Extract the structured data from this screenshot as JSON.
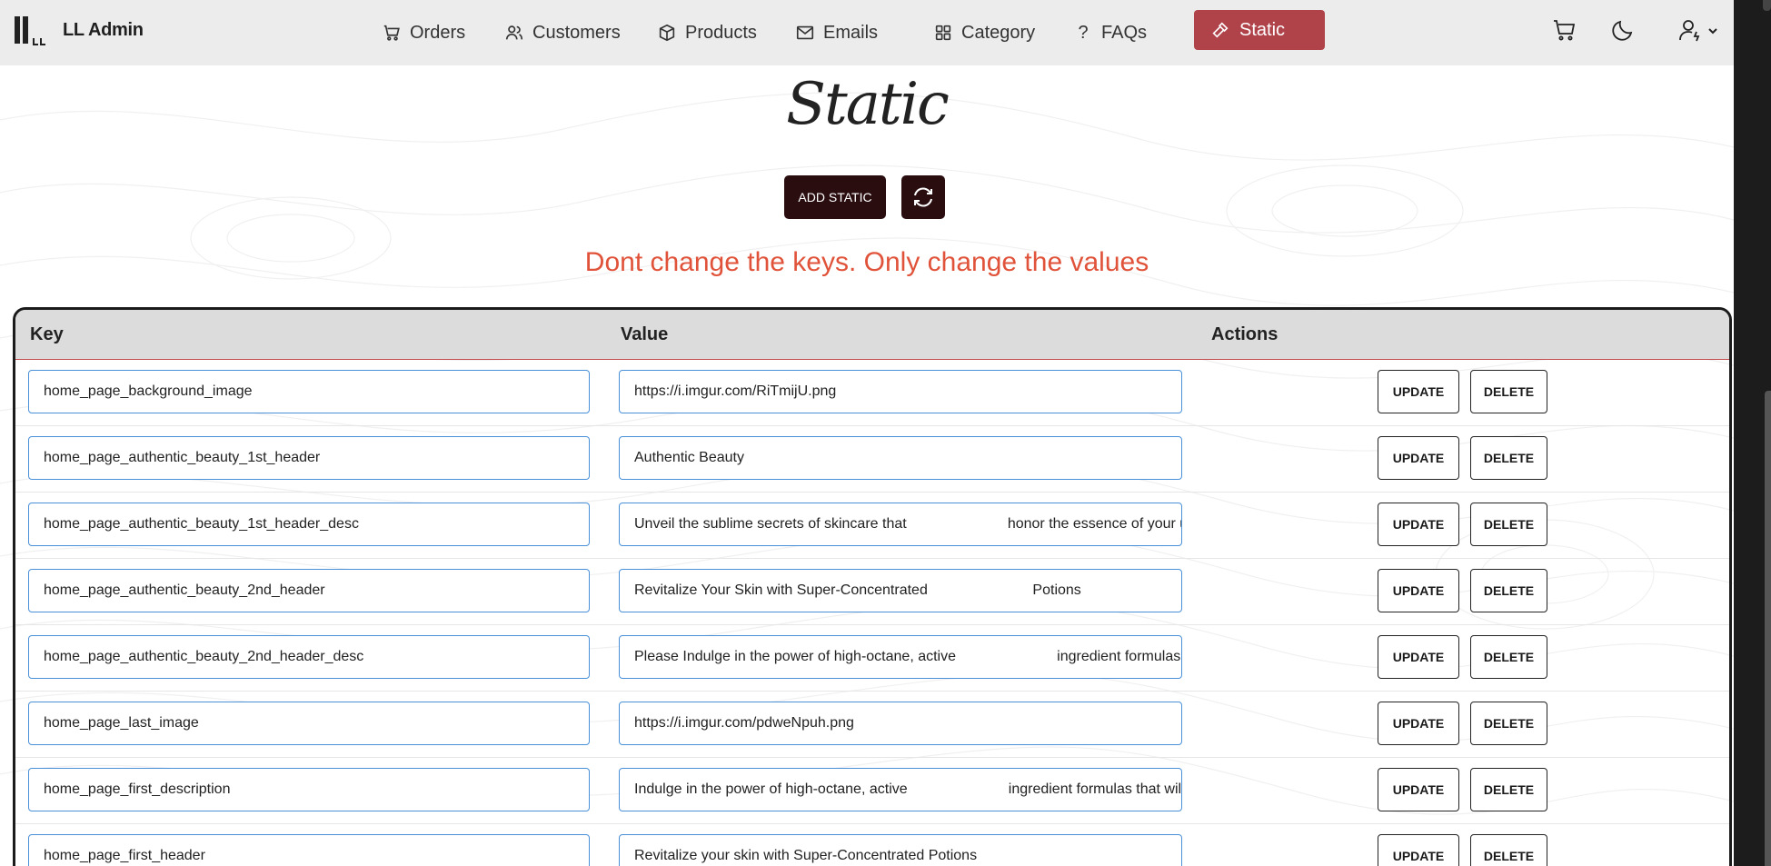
{
  "app": {
    "title": "LL Admin"
  },
  "nav": {
    "items": [
      {
        "label": "Orders",
        "icon": "cart-icon"
      },
      {
        "label": "Customers",
        "icon": "users-icon"
      },
      {
        "label": "Products",
        "icon": "box-icon"
      },
      {
        "label": "Emails",
        "icon": "mail-icon"
      },
      {
        "label": "Category",
        "icon": "grid-icon"
      },
      {
        "label": "FAQs",
        "icon": "question-icon"
      }
    ],
    "active": {
      "label": "Static",
      "icon": "hammer-icon",
      "color": "#b0424a"
    },
    "right_icons": [
      "cart-icon",
      "moon-icon",
      "user-settings-icon",
      "chevron-down-icon"
    ]
  },
  "page": {
    "title": "Static",
    "add_button": "ADD STATIC",
    "refresh_icon": "refresh-icon",
    "warning": "Dont change the keys. Only change the values",
    "warning_color": "#e0533a"
  },
  "table": {
    "headers": {
      "key": "Key",
      "value": "Value",
      "actions": "Actions"
    },
    "update_label": "UPDATE",
    "delete_label": "DELETE",
    "rows": [
      {
        "key": "home_page_background_image",
        "value": "https://i.imgur.com/RiTmijU.png"
      },
      {
        "key": "home_page_authentic_beauty_1st_header",
        "value": "Authentic Beauty"
      },
      {
        "key": "home_page_authentic_beauty_1st_header_desc",
        "value": "Unveil the sublime secrets of skincare that                         honor the essence of your u"
      },
      {
        "key": "home_page_authentic_beauty_2nd_header",
        "value": "Revitalize Your Skin with Super-Concentrated                          Potions"
      },
      {
        "key": "home_page_authentic_beauty_2nd_header_desc",
        "value": "Please Indulge in the power of high-octane, active                         ingredient formulas"
      },
      {
        "key": "home_page_last_image",
        "value": "https://i.imgur.com/pdweNpuh.png"
      },
      {
        "key": "home_page_first_description",
        "value": "Indulge in the power of high-octane, active                         ingredient formulas that will b"
      },
      {
        "key": "home_page_first_header",
        "value": "Revitalize your skin with Super-Concentrated Potions"
      }
    ]
  }
}
